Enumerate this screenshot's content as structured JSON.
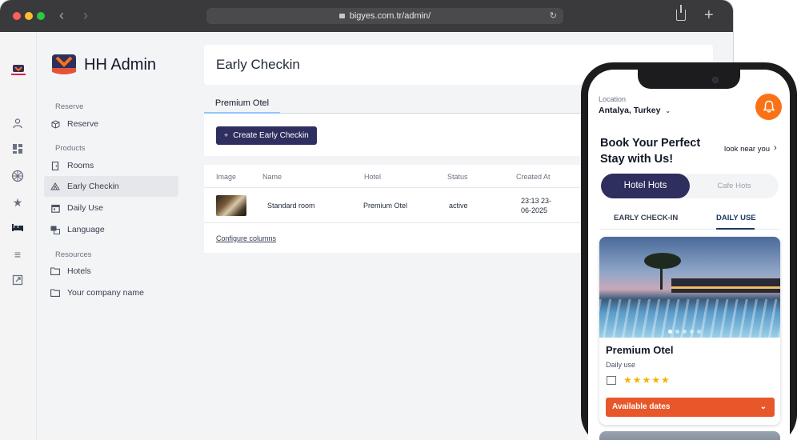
{
  "browser": {
    "url": "bigyes.com.tr/admin/"
  },
  "sidebar": {
    "brand": "HH Admin",
    "sections": {
      "reserve": "Reserve",
      "products": "Products",
      "resources": "Resources"
    },
    "items": [
      {
        "label": "Reserve",
        "icon": "box-icon"
      },
      {
        "label": "Rooms",
        "icon": "door-icon"
      },
      {
        "label": "Early Checkin",
        "icon": "tent-icon",
        "active": true
      },
      {
        "label": "Daily Use",
        "icon": "calendar-icon"
      },
      {
        "label": "Language",
        "icon": "language-icon"
      },
      {
        "label": "Hotels",
        "icon": "folder-icon"
      },
      {
        "label": "Your company name",
        "icon": "folder-icon"
      }
    ]
  },
  "main": {
    "title": "Early Checkin",
    "tab": "Premium Otel",
    "create_button": "Create Early Checkin",
    "table": {
      "columns": [
        "Image",
        "Name",
        "Hotel",
        "Status",
        "Created At"
      ],
      "rows": [
        {
          "name": "Standard room",
          "hotel": "Premium Otel",
          "status": "active",
          "created_at_time": "23:13 23-",
          "created_at_date": "06-2025"
        }
      ]
    },
    "configure_columns": "Configure columns"
  },
  "phone": {
    "location_label": "Location",
    "location": "Antalya, Turkey",
    "headline": "Book Your Perfect Stay with Us!",
    "look_near": "look near you",
    "segments": [
      "Hotel Hots",
      "Cafe Hots"
    ],
    "tabs": [
      "EARLY CHECK-IN",
      "DAILY USE"
    ],
    "card": {
      "name": "Premium Otel",
      "subtitle": "Daily use",
      "stars": "★★★★★",
      "rating": 5,
      "button": "Available dates"
    }
  },
  "colors": {
    "accent": "#2e2f5e",
    "brand_orange": "#f97316",
    "cta_orange": "#e8572a",
    "star": "#f5b301"
  }
}
